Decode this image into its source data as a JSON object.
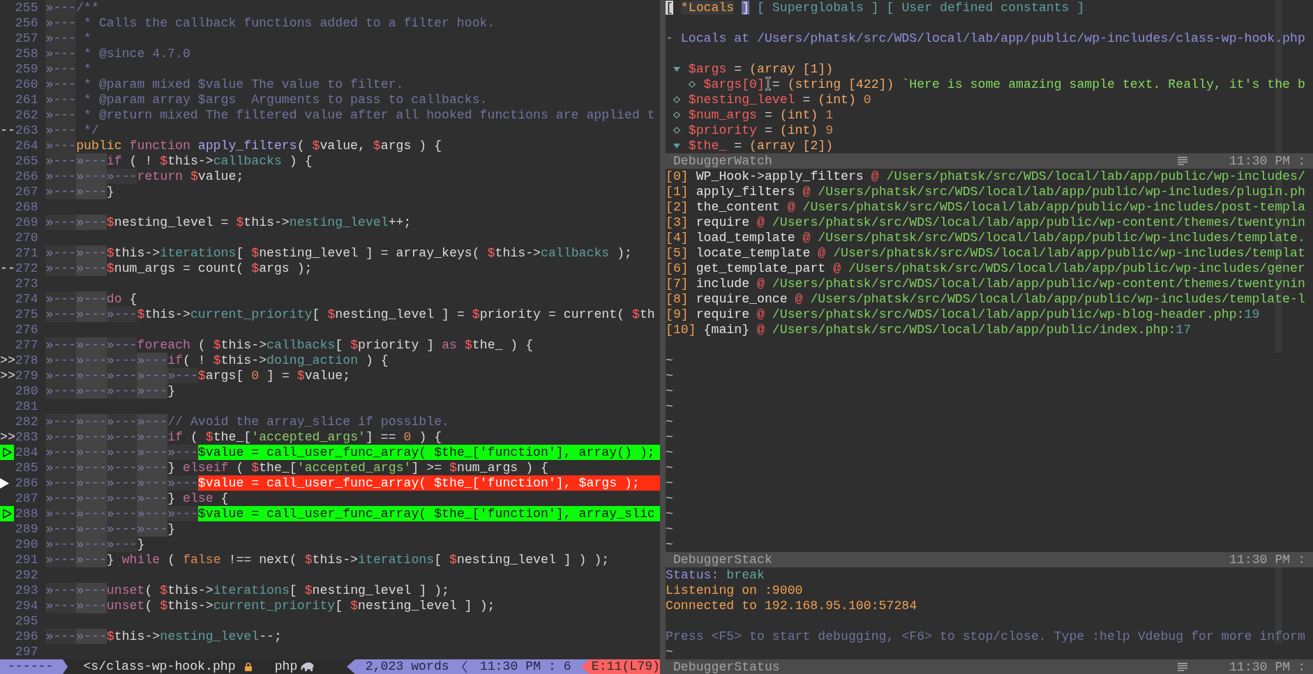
{
  "editor": {
    "lines": [
      {
        "number": "255",
        "indent": [
          "»---"
        ],
        "code": [
          {
            "text": "/**",
            "kind": "comment"
          }
        ]
      },
      {
        "number": "256",
        "indent": [
          "»---"
        ],
        "code": [
          {
            "text": " * Calls the callback functions added to a filter hook.",
            "kind": "comment"
          }
        ]
      },
      {
        "number": "257",
        "indent": [
          "»---"
        ],
        "code": [
          {
            "text": " *",
            "kind": "comment"
          }
        ]
      },
      {
        "number": "258",
        "indent": [
          "»---"
        ],
        "code": [
          {
            "text": " * @since 4.7.0",
            "kind": "comment"
          }
        ]
      },
      {
        "number": "259",
        "indent": [
          "»---"
        ],
        "code": [
          {
            "text": " *",
            "kind": "comment"
          }
        ]
      },
      {
        "number": "260",
        "indent": [
          "»---"
        ],
        "code": [
          {
            "text": " * @param mixed $value The value to filter.",
            "kind": "comment"
          }
        ]
      },
      {
        "number": "261",
        "indent": [
          "»---"
        ],
        "code": [
          {
            "text": " * @param array $args  Arguments to pass to callbacks.",
            "kind": "comment"
          }
        ]
      },
      {
        "number": "262",
        "indent": [
          "»---"
        ],
        "code": [
          {
            "text": " * @return mixed The filtered value after all hooked functions are applied t",
            "kind": "comment"
          }
        ]
      },
      {
        "number": "263",
        "sign": {
          "kind": "text",
          "text": "--"
        },
        "indent": [
          "»---"
        ],
        "code": [
          {
            "text": " */",
            "kind": "comment"
          }
        ]
      },
      {
        "number": "264",
        "indent": [
          "»---"
        ],
        "code": [
          {
            "text": "public ",
            "kind": "storage"
          },
          {
            "text": "function ",
            "kind": "keyword"
          },
          {
            "text": "apply_filters",
            "kind": "function"
          },
          {
            "text": "( ",
            "kind": "plain"
          },
          {
            "text": "$",
            "kind": "sigil"
          },
          {
            "text": "value, ",
            "kind": "plain"
          },
          {
            "text": "$",
            "kind": "sigil"
          },
          {
            "text": "args ) {",
            "kind": "plain"
          }
        ]
      },
      {
        "number": "265",
        "indent": [
          "»---",
          "»---"
        ],
        "code": [
          {
            "text": "if",
            "kind": "keyword"
          },
          {
            "text": " ( ! ",
            "kind": "plain"
          },
          {
            "text": "$",
            "kind": "sigil"
          },
          {
            "text": "this->",
            "kind": "plain"
          },
          {
            "text": "callbacks",
            "kind": "property"
          },
          {
            "text": " ) {",
            "kind": "plain"
          }
        ]
      },
      {
        "number": "266",
        "indent": [
          "»---",
          "»---",
          "»---"
        ],
        "code": [
          {
            "text": "return ",
            "kind": "keyword"
          },
          {
            "text": "$",
            "kind": "sigil"
          },
          {
            "text": "value;",
            "kind": "plain"
          }
        ]
      },
      {
        "number": "267",
        "indent": [
          "»---",
          "»---"
        ],
        "code": [
          {
            "text": "}",
            "kind": "plain"
          }
        ]
      },
      {
        "number": "268"
      },
      {
        "number": "269",
        "indent": [
          "»---",
          "»---"
        ],
        "code": [
          {
            "text": "$",
            "kind": "sigil"
          },
          {
            "text": "nesting_level = ",
            "kind": "plain"
          },
          {
            "text": "$",
            "kind": "sigil"
          },
          {
            "text": "this->",
            "kind": "plain"
          },
          {
            "text": "nesting_level",
            "kind": "property"
          },
          {
            "text": "++;",
            "kind": "plain"
          }
        ]
      },
      {
        "number": "270"
      },
      {
        "number": "271",
        "indent": [
          "»---",
          "»---"
        ],
        "code": [
          {
            "text": "$",
            "kind": "sigil"
          },
          {
            "text": "this->",
            "kind": "plain"
          },
          {
            "text": "iterations",
            "kind": "property"
          },
          {
            "text": "[ ",
            "kind": "plain"
          },
          {
            "text": "$",
            "kind": "sigil"
          },
          {
            "text": "nesting_level ] = array_keys( ",
            "kind": "plain"
          },
          {
            "text": "$",
            "kind": "sigil"
          },
          {
            "text": "this->",
            "kind": "plain"
          },
          {
            "text": "callbacks",
            "kind": "property"
          },
          {
            "text": " );",
            "kind": "plain"
          }
        ]
      },
      {
        "number": "272",
        "sign": {
          "kind": "text",
          "text": "--"
        },
        "indent": [
          "»---",
          "»---"
        ],
        "code": [
          {
            "text": "$",
            "kind": "sigil"
          },
          {
            "text": "num_args = count( ",
            "kind": "plain"
          },
          {
            "text": "$",
            "kind": "sigil"
          },
          {
            "text": "args );",
            "kind": "plain"
          }
        ]
      },
      {
        "number": "273"
      },
      {
        "number": "274",
        "indent": [
          "»---",
          "»---"
        ],
        "code": [
          {
            "text": "do",
            "kind": "keyword"
          },
          {
            "text": " {",
            "kind": "plain"
          }
        ]
      },
      {
        "number": "275",
        "indent": [
          "»---",
          "»---",
          "»---"
        ],
        "code": [
          {
            "text": "$",
            "kind": "sigil"
          },
          {
            "text": "this->",
            "kind": "plain"
          },
          {
            "text": "current_priority",
            "kind": "property"
          },
          {
            "text": "[ ",
            "kind": "plain"
          },
          {
            "text": "$",
            "kind": "sigil"
          },
          {
            "text": "nesting_level ] = ",
            "kind": "plain"
          },
          {
            "text": "$",
            "kind": "sigil"
          },
          {
            "text": "priority = current( ",
            "kind": "plain"
          },
          {
            "text": "$",
            "kind": "sigil"
          },
          {
            "text": "th",
            "kind": "plain"
          }
        ]
      },
      {
        "number": "276"
      },
      {
        "number": "277",
        "indent": [
          "»---",
          "»---",
          "»---"
        ],
        "code": [
          {
            "text": "foreach",
            "kind": "keyword"
          },
          {
            "text": " ( ",
            "kind": "plain"
          },
          {
            "text": "$",
            "kind": "sigil"
          },
          {
            "text": "this->",
            "kind": "plain"
          },
          {
            "text": "callbacks",
            "kind": "property"
          },
          {
            "text": "[ ",
            "kind": "plain"
          },
          {
            "text": "$",
            "kind": "sigil"
          },
          {
            "text": "priority ] ",
            "kind": "plain"
          },
          {
            "text": "as ",
            "kind": "keyword"
          },
          {
            "text": "$",
            "kind": "sigil"
          },
          {
            "text": "the_ ) {",
            "kind": "plain"
          }
        ]
      },
      {
        "number": "278",
        "sign": {
          "kind": "text",
          "text": ">>"
        },
        "indent": [
          "»---",
          "»---",
          "»---",
          "»---"
        ],
        "code": [
          {
            "text": "if",
            "kind": "keyword"
          },
          {
            "text": "( ! ",
            "kind": "plain"
          },
          {
            "text": "$",
            "kind": "sigil"
          },
          {
            "text": "this->",
            "kind": "plain"
          },
          {
            "text": "doing_action",
            "kind": "property"
          },
          {
            "text": " ) {",
            "kind": "plain"
          }
        ]
      },
      {
        "number": "279",
        "sign": {
          "kind": "text",
          "text": ">>"
        },
        "indent": [
          "»---",
          "»---",
          "»---",
          "»---",
          "»---"
        ],
        "code": [
          {
            "text": "$",
            "kind": "sigil"
          },
          {
            "text": "args[ ",
            "kind": "plain"
          },
          {
            "text": "0",
            "kind": "number"
          },
          {
            "text": " ] = ",
            "kind": "plain"
          },
          {
            "text": "$",
            "kind": "sigil"
          },
          {
            "text": "value;",
            "kind": "plain"
          }
        ]
      },
      {
        "number": "280",
        "indent": [
          "»---",
          "»---",
          "»---",
          "»---"
        ],
        "code": [
          {
            "text": "}",
            "kind": "plain"
          }
        ]
      },
      {
        "number": "281"
      },
      {
        "number": "282",
        "indent": [
          "»---",
          "»---",
          "»---",
          "»---"
        ],
        "code": [
          {
            "text": "// Avoid the array_slice if possible.",
            "kind": "comment"
          }
        ]
      },
      {
        "number": "283",
        "sign": {
          "kind": "text",
          "text": ">>"
        },
        "indent": [
          "»---",
          "»---",
          "»---",
          "»---"
        ],
        "code": [
          {
            "text": "if",
            "kind": "keyword"
          },
          {
            "text": " ( ",
            "kind": "plain"
          },
          {
            "text": "$",
            "kind": "sigil"
          },
          {
            "text": "the_[",
            "kind": "plain"
          },
          {
            "text": "'accepted_args'",
            "kind": "string"
          },
          {
            "text": "] == ",
            "kind": "plain"
          },
          {
            "text": "0",
            "kind": "number"
          },
          {
            "text": " ) {",
            "kind": "plain"
          }
        ]
      },
      {
        "number": "284",
        "sign": {
          "kind": "breakpoint"
        },
        "indent": [
          "»---",
          "»---",
          "»---",
          "»---",
          "»---"
        ],
        "code": [
          {
            "text": "$",
            "kind": "sigil"
          },
          {
            "text": "value = call_user_func_array( ",
            "kind": "plain"
          },
          {
            "text": "$",
            "kind": "sigil"
          },
          {
            "text": "the_[",
            "kind": "plain"
          },
          {
            "text": "'function'",
            "kind": "string"
          },
          {
            "text": "], array() );",
            "kind": "plain"
          }
        ]
      },
      {
        "number": "285",
        "indent": [
          "»---",
          "»---",
          "»---",
          "»---"
        ],
        "code": [
          {
            "text": "} ",
            "kind": "plain"
          },
          {
            "text": "elseif",
            "kind": "keyword"
          },
          {
            "text": " ( ",
            "kind": "plain"
          },
          {
            "text": "$",
            "kind": "sigil"
          },
          {
            "text": "the_[",
            "kind": "plain"
          },
          {
            "text": "'accepted_args'",
            "kind": "string"
          },
          {
            "text": "] >= ",
            "kind": "plain"
          },
          {
            "text": "$",
            "kind": "sigil"
          },
          {
            "text": "num_args ) {",
            "kind": "plain"
          }
        ]
      },
      {
        "number": "286",
        "sign": {
          "kind": "current"
        },
        "indent": [
          "»---",
          "»---",
          "»---",
          "»---",
          "»---"
        ],
        "code": [
          {
            "text": "$",
            "kind": "sigil"
          },
          {
            "text": "value = call_user_func_array( ",
            "kind": "plain"
          },
          {
            "text": "$",
            "kind": "sigil"
          },
          {
            "text": "the_[",
            "kind": "plain"
          },
          {
            "text": "'function'",
            "kind": "string"
          },
          {
            "text": "], ",
            "kind": "plain"
          },
          {
            "text": "$",
            "kind": "sigil"
          },
          {
            "text": "args );",
            "kind": "plain"
          }
        ]
      },
      {
        "number": "287",
        "indent": [
          "»---",
          "»---",
          "»---",
          "»---"
        ],
        "code": [
          {
            "text": "} ",
            "kind": "plain"
          },
          {
            "text": "else",
            "kind": "keyword"
          },
          {
            "text": " {",
            "kind": "plain"
          }
        ]
      },
      {
        "number": "288",
        "sign": {
          "kind": "breakpoint"
        },
        "indent": [
          "»---",
          "»---",
          "»---",
          "»---",
          "»---"
        ],
        "code": [
          {
            "text": "$",
            "kind": "sigil"
          },
          {
            "text": "value = call_user_func_array( ",
            "kind": "plain"
          },
          {
            "text": "$",
            "kind": "sigil"
          },
          {
            "text": "the_[",
            "kind": "plain"
          },
          {
            "text": "'function'",
            "kind": "string"
          },
          {
            "text": "], array_slic",
            "kind": "plain"
          }
        ]
      },
      {
        "number": "289",
        "indent": [
          "»---",
          "»---",
          "»---",
          "»---"
        ],
        "code": [
          {
            "text": "}",
            "kind": "plain"
          }
        ]
      },
      {
        "number": "290",
        "indent": [
          "»---",
          "»---",
          "»---"
        ],
        "code": [
          {
            "text": "}",
            "kind": "plain"
          }
        ]
      },
      {
        "number": "291",
        "indent": [
          "»---",
          "»---"
        ],
        "code": [
          {
            "text": "} ",
            "kind": "plain"
          },
          {
            "text": "while",
            "kind": "keyword"
          },
          {
            "text": " ( ",
            "kind": "plain"
          },
          {
            "text": "false",
            "kind": "number"
          },
          {
            "text": " !== next( ",
            "kind": "plain"
          },
          {
            "text": "$",
            "kind": "sigil"
          },
          {
            "text": "this->",
            "kind": "plain"
          },
          {
            "text": "iterations",
            "kind": "property"
          },
          {
            "text": "[ ",
            "kind": "plain"
          },
          {
            "text": "$",
            "kind": "sigil"
          },
          {
            "text": "nesting_level ] ) );",
            "kind": "plain"
          }
        ]
      },
      {
        "number": "292"
      },
      {
        "number": "293",
        "indent": [
          "»---",
          "»---"
        ],
        "code": [
          {
            "text": "unset",
            "kind": "keyword"
          },
          {
            "text": "( ",
            "kind": "plain"
          },
          {
            "text": "$",
            "kind": "sigil"
          },
          {
            "text": "this->",
            "kind": "plain"
          },
          {
            "text": "iterations",
            "kind": "property"
          },
          {
            "text": "[ ",
            "kind": "plain"
          },
          {
            "text": "$",
            "kind": "sigil"
          },
          {
            "text": "nesting_level ] );",
            "kind": "plain"
          }
        ]
      },
      {
        "number": "294",
        "indent": [
          "»---",
          "»---"
        ],
        "code": [
          {
            "text": "unset",
            "kind": "keyword"
          },
          {
            "text": "( ",
            "kind": "plain"
          },
          {
            "text": "$",
            "kind": "sigil"
          },
          {
            "text": "this->",
            "kind": "plain"
          },
          {
            "text": "current_priority",
            "kind": "property"
          },
          {
            "text": "[ ",
            "kind": "plain"
          },
          {
            "text": "$",
            "kind": "sigil"
          },
          {
            "text": "nesting_level ] );",
            "kind": "plain"
          }
        ]
      },
      {
        "number": "295"
      },
      {
        "number": "296",
        "indent": [
          "»---",
          "»---"
        ],
        "code": [
          {
            "text": "$",
            "kind": "sigil"
          },
          {
            "text": "this->",
            "kind": "plain"
          },
          {
            "text": "nesting_level",
            "kind": "property"
          },
          {
            "text": "--;",
            "kind": "plain"
          }
        ]
      },
      {
        "number": "297"
      }
    ],
    "status_bar": {
      "mode": "------",
      "file": "<s/class-wp-hook.php",
      "readonly": true,
      "filetype": "php",
      "words": "2,023 words",
      "position": "11:30 PM : 6",
      "errors": "E:11(L79)"
    }
  },
  "debugger": {
    "watch": {
      "tabs": [
        {
          "open": "[",
          "label": "*Locals",
          "close": "]",
          "selected": true,
          "cursor": true
        },
        {
          "open": "[",
          "label": "Superglobals",
          "close": "]",
          "selected": false,
          "cursor": false
        },
        {
          "open": "[",
          "label": "User defined constants",
          "close": "]",
          "selected": false,
          "cursor": false
        }
      ],
      "heading": "- Locals at /Users/phatsk/src/WDS/local/lab/app/public/wp-includes/class-wp-hook.php",
      "variables": [
        {
          "kind": "array",
          "expanded": true,
          "name": "$args",
          "operator": "=",
          "type": "(array [1])",
          "children": [
            {
              "kind": "string",
              "name": "$args[0]",
              "operator": "=",
              "type": "(string [422])",
              "value": "`Here is some amazing sample text. Really, it's the b"
            }
          ]
        },
        {
          "kind": "int",
          "name": "$nesting_level",
          "operator": "=",
          "type": "(int)",
          "value": "0"
        },
        {
          "kind": "int",
          "name": "$num_args",
          "operator": "=",
          "type": "(int)",
          "value": "1"
        },
        {
          "kind": "int",
          "name": "$priority",
          "operator": "=",
          "type": "(int)",
          "value": "9"
        },
        {
          "kind": "array",
          "expanded": true,
          "name": "$the_",
          "operator": "=",
          "type": "(array [2])"
        }
      ],
      "status_line": {
        "name": "DebuggerWatch",
        "lines_icon": true,
        "clock": "11:30 PM :"
      }
    },
    "stack": {
      "frames": [
        {
          "index": "[0]",
          "function": "WP_Hook->apply_filters",
          "at": "@",
          "path": "/Users/phatsk/src/WDS/local/lab/app/public/wp-includes/"
        },
        {
          "index": "[1]",
          "function": "apply_filters",
          "at": "@",
          "path": "/Users/phatsk/src/WDS/local/lab/app/public/wp-includes/plugin.ph"
        },
        {
          "index": "[2]",
          "function": "the_content",
          "at": "@",
          "path": "/Users/phatsk/src/WDS/local/lab/app/public/wp-includes/post-templa"
        },
        {
          "index": "[3]",
          "function": "require",
          "at": "@",
          "path": "/Users/phatsk/src/WDS/local/lab/app/public/wp-content/themes/twentynin"
        },
        {
          "index": "[4]",
          "function": "load_template",
          "at": "@",
          "path": "/Users/phatsk/src/WDS/local/lab/app/public/wp-includes/template."
        },
        {
          "index": "[5]",
          "function": "locate_template",
          "at": "@",
          "path": "/Users/phatsk/src/WDS/local/lab/app/public/wp-includes/templat"
        },
        {
          "index": "[6]",
          "function": "get_template_part",
          "at": "@",
          "path": "/Users/phatsk/src/WDS/local/lab/app/public/wp-includes/gener"
        },
        {
          "index": "[7]",
          "function": "include",
          "at": "@",
          "path": "/Users/phatsk/src/WDS/local/lab/app/public/wp-content/themes/twentynin"
        },
        {
          "index": "[8]",
          "function": "require_once",
          "at": "@",
          "path": "/Users/phatsk/src/WDS/local/lab/app/public/wp-includes/template-l"
        },
        {
          "index": "[9]",
          "function": "require",
          "at": "@",
          "path": "/Users/phatsk/src/WDS/local/lab/app/public/wp-blog-header.php:",
          "line": "19"
        },
        {
          "index": "[10]",
          "function": "{main}",
          "at": "@",
          "path": "/Users/phatsk/src/WDS/local/lab/app/public/index.php:",
          "line": "17"
        }
      ],
      "tildes": [
        "~",
        "~",
        "~",
        "~",
        "~",
        "~",
        "~",
        "~",
        "~",
        "~",
        "~",
        "~",
        "~"
      ],
      "status_line": {
        "name": "DebuggerStack",
        "lines_icon": false,
        "clock": "11:30 PM :"
      }
    },
    "console": {
      "lines": [
        {
          "kind": "status",
          "label": "Status:",
          "value": "break"
        },
        {
          "kind": "info",
          "text": "Listening on :9000"
        },
        {
          "kind": "info",
          "text": "Connected to 192.168.95.100:57284"
        },
        {
          "kind": "hint",
          "text": "Press <F5> to start debugging, <F6> to stop/close. Type :help Vdebug for more inform"
        }
      ],
      "tildes": [
        "~"
      ],
      "status_line": {
        "name": "DebuggerStatus",
        "lines_icon": true,
        "clock": "11:30 PM :"
      }
    }
  }
}
